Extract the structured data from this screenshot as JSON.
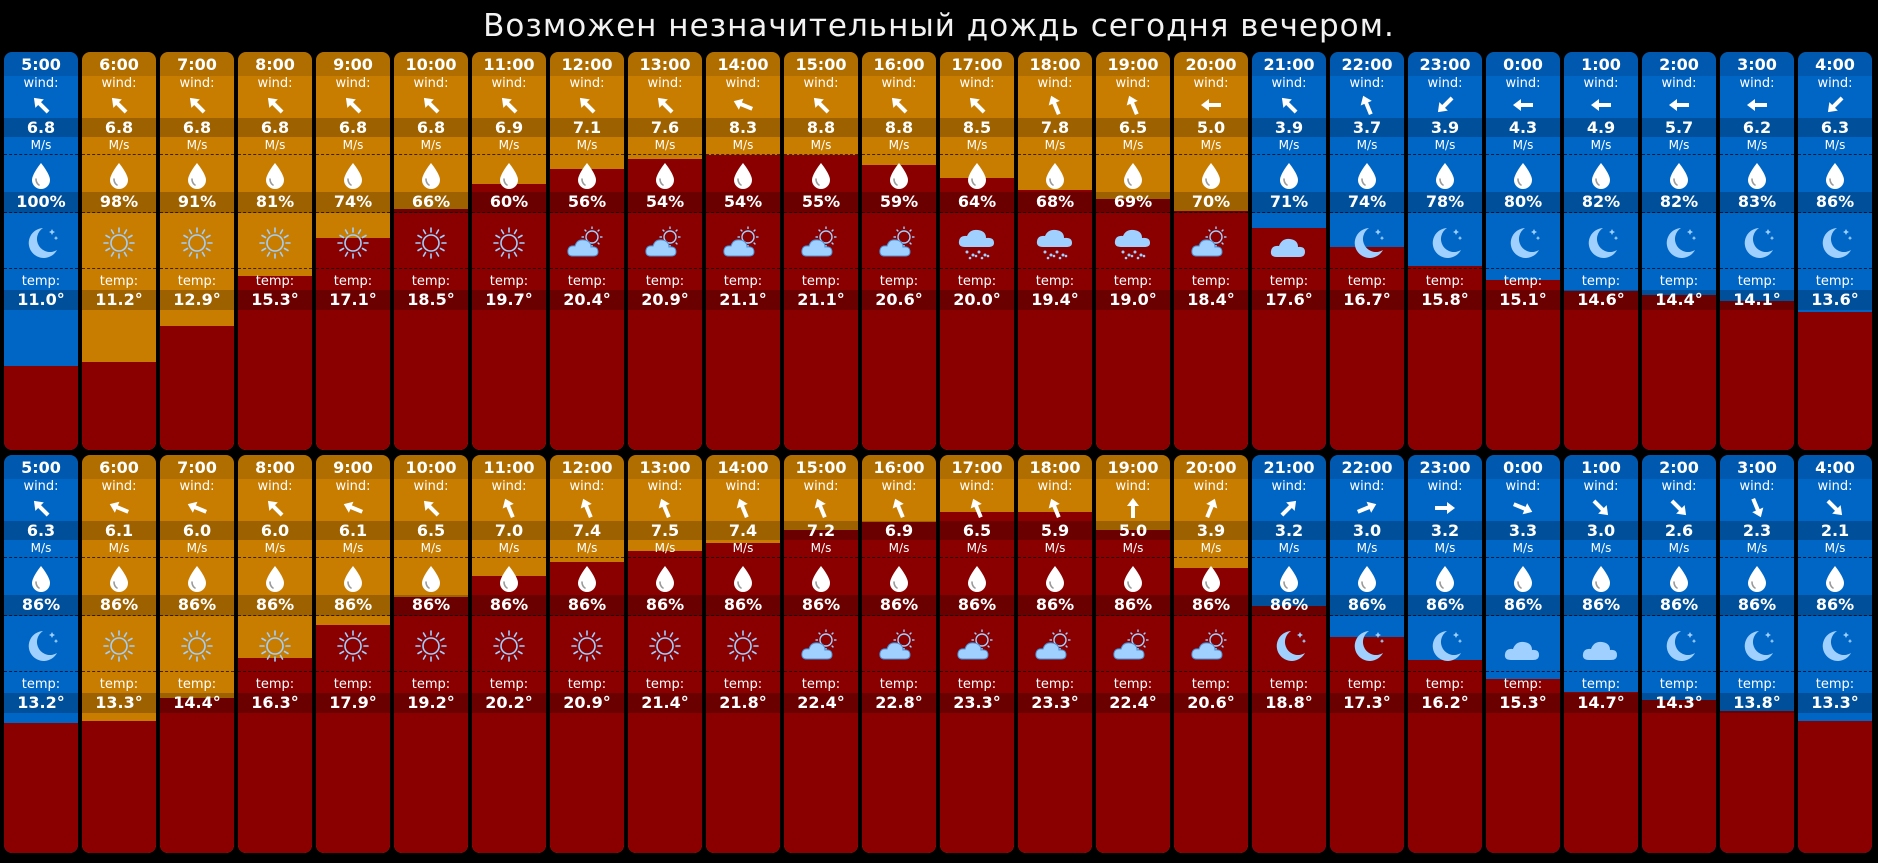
{
  "headline": "Возможен незначительный дождь сегодня вечером.",
  "labels": {
    "wind": "wind:",
    "speed_unit": "M/s",
    "temp": "temp:"
  },
  "colors": {
    "day": "#c97d00",
    "night": "#0066c6",
    "temperature_fill": "#8a0000",
    "icon": "#9fd0ff"
  },
  "rows": [
    {
      "hours": [
        {
          "time": "5:00",
          "is_day": false,
          "wind_dir": "northwest",
          "wind_speed": "6.8",
          "humidity": "100%",
          "condition": "moon-icon",
          "temp": "11.0°",
          "temp_c": 11.0
        },
        {
          "time": "6:00",
          "is_day": true,
          "wind_dir": "northwest",
          "wind_speed": "6.8",
          "humidity": "98%",
          "condition": "sun-icon",
          "temp": "11.2°",
          "temp_c": 11.2
        },
        {
          "time": "7:00",
          "is_day": true,
          "wind_dir": "northwest",
          "wind_speed": "6.8",
          "humidity": "91%",
          "condition": "sun-icon",
          "temp": "12.9°",
          "temp_c": 12.9
        },
        {
          "time": "8:00",
          "is_day": true,
          "wind_dir": "northwest",
          "wind_speed": "6.8",
          "humidity": "81%",
          "condition": "sun-icon",
          "temp": "15.3°",
          "temp_c": 15.3
        },
        {
          "time": "9:00",
          "is_day": true,
          "wind_dir": "northwest",
          "wind_speed": "6.8",
          "humidity": "74%",
          "condition": "sun-icon",
          "temp": "17.1°",
          "temp_c": 17.1
        },
        {
          "time": "10:00",
          "is_day": true,
          "wind_dir": "northwest",
          "wind_speed": "6.8",
          "humidity": "66%",
          "condition": "sun-icon",
          "temp": "18.5°",
          "temp_c": 18.5
        },
        {
          "time": "11:00",
          "is_day": true,
          "wind_dir": "northwest",
          "wind_speed": "6.9",
          "humidity": "60%",
          "condition": "sun-icon",
          "temp": "19.7°",
          "temp_c": 19.7
        },
        {
          "time": "12:00",
          "is_day": true,
          "wind_dir": "northwest",
          "wind_speed": "7.1",
          "humidity": "56%",
          "condition": "cloud-sun-icon",
          "temp": "20.4°",
          "temp_c": 20.4
        },
        {
          "time": "13:00",
          "is_day": true,
          "wind_dir": "northwest",
          "wind_speed": "7.6",
          "humidity": "54%",
          "condition": "cloud-sun-icon",
          "temp": "20.9°",
          "temp_c": 20.9
        },
        {
          "time": "14:00",
          "is_day": true,
          "wind_dir": "west-northwest",
          "wind_speed": "8.3",
          "humidity": "54%",
          "condition": "cloud-sun-icon",
          "temp": "21.1°",
          "temp_c": 21.1
        },
        {
          "time": "15:00",
          "is_day": true,
          "wind_dir": "northwest",
          "wind_speed": "8.8",
          "humidity": "55%",
          "condition": "cloud-sun-icon",
          "temp": "21.1°",
          "temp_c": 21.1
        },
        {
          "time": "16:00",
          "is_day": true,
          "wind_dir": "northwest",
          "wind_speed": "8.8",
          "humidity": "59%",
          "condition": "cloud-sun-icon",
          "temp": "20.6°",
          "temp_c": 20.6
        },
        {
          "time": "17:00",
          "is_day": true,
          "wind_dir": "northwest",
          "wind_speed": "8.5",
          "humidity": "64%",
          "condition": "rain-cloud-icon",
          "temp": "20.0°",
          "temp_c": 20.0
        },
        {
          "time": "18:00",
          "is_day": true,
          "wind_dir": "north-northwest",
          "wind_speed": "7.8",
          "humidity": "68%",
          "condition": "rain-cloud-icon",
          "temp": "19.4°",
          "temp_c": 19.4
        },
        {
          "time": "19:00",
          "is_day": true,
          "wind_dir": "north-northwest",
          "wind_speed": "6.5",
          "humidity": "69%",
          "condition": "rain-cloud-icon",
          "temp": "19.0°",
          "temp_c": 19.0
        },
        {
          "time": "20:00",
          "is_day": true,
          "wind_dir": "west",
          "wind_speed": "5.0",
          "humidity": "70%",
          "condition": "cloud-sun-icon",
          "temp": "18.4°",
          "temp_c": 18.4
        },
        {
          "time": "21:00",
          "is_day": false,
          "wind_dir": "northwest",
          "wind_speed": "3.9",
          "humidity": "71%",
          "condition": "cloud-icon",
          "temp": "17.6°",
          "temp_c": 17.6
        },
        {
          "time": "22:00",
          "is_day": false,
          "wind_dir": "north-northwest",
          "wind_speed": "3.7",
          "humidity": "74%",
          "condition": "moon-icon",
          "temp": "16.7°",
          "temp_c": 16.7
        },
        {
          "time": "23:00",
          "is_day": false,
          "wind_dir": "southwest",
          "wind_speed": "3.9",
          "humidity": "78%",
          "condition": "moon-icon",
          "temp": "15.8°",
          "temp_c": 15.8
        },
        {
          "time": "0:00",
          "is_day": false,
          "wind_dir": "west",
          "wind_speed": "4.3",
          "humidity": "80%",
          "condition": "moon-icon",
          "temp": "15.1°",
          "temp_c": 15.1
        },
        {
          "time": "1:00",
          "is_day": false,
          "wind_dir": "west",
          "wind_speed": "4.9",
          "humidity": "82%",
          "condition": "moon-icon",
          "temp": "14.6°",
          "temp_c": 14.6
        },
        {
          "time": "2:00",
          "is_day": false,
          "wind_dir": "west",
          "wind_speed": "5.7",
          "humidity": "82%",
          "condition": "moon-icon",
          "temp": "14.4°",
          "temp_c": 14.4
        },
        {
          "time": "3:00",
          "is_day": false,
          "wind_dir": "west",
          "wind_speed": "6.2",
          "humidity": "83%",
          "condition": "moon-icon",
          "temp": "14.1°",
          "temp_c": 14.1
        },
        {
          "time": "4:00",
          "is_day": false,
          "wind_dir": "southwest",
          "wind_speed": "6.3",
          "humidity": "86%",
          "condition": "moon-icon",
          "temp": "13.6°",
          "temp_c": 13.6
        }
      ]
    },
    {
      "hours": [
        {
          "time": "5:00",
          "is_day": false,
          "wind_dir": "northwest",
          "wind_speed": "6.3",
          "humidity": "86%",
          "condition": "moon-icon",
          "temp": "13.2°",
          "temp_c": 13.2
        },
        {
          "time": "6:00",
          "is_day": true,
          "wind_dir": "west-northwest",
          "wind_speed": "6.1",
          "humidity": "86%",
          "condition": "sun-icon",
          "temp": "13.3°",
          "temp_c": 13.3
        },
        {
          "time": "7:00",
          "is_day": true,
          "wind_dir": "west-northwest",
          "wind_speed": "6.0",
          "humidity": "86%",
          "condition": "sun-icon",
          "temp": "14.4°",
          "temp_c": 14.4
        },
        {
          "time": "8:00",
          "is_day": true,
          "wind_dir": "northwest",
          "wind_speed": "6.0",
          "humidity": "86%",
          "condition": "sun-icon",
          "temp": "16.3°",
          "temp_c": 16.3
        },
        {
          "time": "9:00",
          "is_day": true,
          "wind_dir": "west-northwest",
          "wind_speed": "6.1",
          "humidity": "86%",
          "condition": "sun-icon",
          "temp": "17.9°",
          "temp_c": 17.9
        },
        {
          "time": "10:00",
          "is_day": true,
          "wind_dir": "northwest",
          "wind_speed": "6.5",
          "humidity": "86%",
          "condition": "sun-icon",
          "temp": "19.2°",
          "temp_c": 19.2
        },
        {
          "time": "11:00",
          "is_day": true,
          "wind_dir": "north-northwest",
          "wind_speed": "7.0",
          "humidity": "86%",
          "condition": "sun-icon",
          "temp": "20.2°",
          "temp_c": 20.2
        },
        {
          "time": "12:00",
          "is_day": true,
          "wind_dir": "north-northwest",
          "wind_speed": "7.4",
          "humidity": "86%",
          "condition": "sun-icon",
          "temp": "20.9°",
          "temp_c": 20.9
        },
        {
          "time": "13:00",
          "is_day": true,
          "wind_dir": "north-northwest",
          "wind_speed": "7.5",
          "humidity": "86%",
          "condition": "sun-icon",
          "temp": "21.4°",
          "temp_c": 21.4
        },
        {
          "time": "14:00",
          "is_day": true,
          "wind_dir": "north-northwest",
          "wind_speed": "7.4",
          "humidity": "86%",
          "condition": "sun-icon",
          "temp": "21.8°",
          "temp_c": 21.8
        },
        {
          "time": "15:00",
          "is_day": true,
          "wind_dir": "north-northwest",
          "wind_speed": "7.2",
          "humidity": "86%",
          "condition": "cloud-sun-icon",
          "temp": "22.4°",
          "temp_c": 22.4
        },
        {
          "time": "16:00",
          "is_day": true,
          "wind_dir": "north-northwest",
          "wind_speed": "6.9",
          "humidity": "86%",
          "condition": "cloud-sun-icon",
          "temp": "22.8°",
          "temp_c": 22.8
        },
        {
          "time": "17:00",
          "is_day": true,
          "wind_dir": "north-northwest",
          "wind_speed": "6.5",
          "humidity": "86%",
          "condition": "cloud-sun-icon",
          "temp": "23.3°",
          "temp_c": 23.3
        },
        {
          "time": "18:00",
          "is_day": true,
          "wind_dir": "north-northwest",
          "wind_speed": "5.9",
          "humidity": "86%",
          "condition": "cloud-sun-icon",
          "temp": "23.3°",
          "temp_c": 23.3
        },
        {
          "time": "19:00",
          "is_day": true,
          "wind_dir": "north",
          "wind_speed": "5.0",
          "humidity": "86%",
          "condition": "cloud-sun-icon",
          "temp": "22.4°",
          "temp_c": 22.4
        },
        {
          "time": "20:00",
          "is_day": true,
          "wind_dir": "north-northeast",
          "wind_speed": "3.9",
          "humidity": "86%",
          "condition": "cloud-sun-icon",
          "temp": "20.6°",
          "temp_c": 20.6
        },
        {
          "time": "21:00",
          "is_day": false,
          "wind_dir": "northeast",
          "wind_speed": "3.2",
          "humidity": "86%",
          "condition": "moon-icon",
          "temp": "18.8°",
          "temp_c": 18.8
        },
        {
          "time": "22:00",
          "is_day": false,
          "wind_dir": "east-northeast",
          "wind_speed": "3.0",
          "humidity": "86%",
          "condition": "moon-icon",
          "temp": "17.3°",
          "temp_c": 17.3
        },
        {
          "time": "23:00",
          "is_day": false,
          "wind_dir": "east",
          "wind_speed": "3.2",
          "humidity": "86%",
          "condition": "moon-icon",
          "temp": "16.2°",
          "temp_c": 16.2
        },
        {
          "time": "0:00",
          "is_day": false,
          "wind_dir": "east-southeast",
          "wind_speed": "3.3",
          "humidity": "86%",
          "condition": "cloud-icon",
          "temp": "15.3°",
          "temp_c": 15.3
        },
        {
          "time": "1:00",
          "is_day": false,
          "wind_dir": "southeast",
          "wind_speed": "3.0",
          "humidity": "86%",
          "condition": "cloud-icon",
          "temp": "14.7°",
          "temp_c": 14.7
        },
        {
          "time": "2:00",
          "is_day": false,
          "wind_dir": "southeast",
          "wind_speed": "2.6",
          "humidity": "86%",
          "condition": "moon-icon",
          "temp": "14.3°",
          "temp_c": 14.3
        },
        {
          "time": "3:00",
          "is_day": false,
          "wind_dir": "south-southeast",
          "wind_speed": "2.3",
          "humidity": "86%",
          "condition": "moon-icon",
          "temp": "13.8°",
          "temp_c": 13.8
        },
        {
          "time": "4:00",
          "is_day": false,
          "wind_dir": "southeast",
          "wind_speed": "2.1",
          "humidity": "86%",
          "condition": "moon-icon",
          "temp": "13.3°",
          "temp_c": 13.3
        }
      ]
    }
  ]
}
